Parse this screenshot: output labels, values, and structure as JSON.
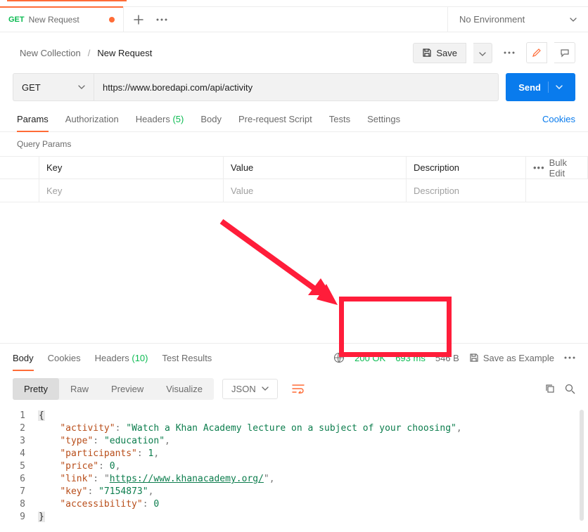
{
  "tab": {
    "method": "GET",
    "name": "New Request",
    "dirty": true
  },
  "env": {
    "label": "No Environment"
  },
  "breadcrumb": {
    "collection": "New Collection",
    "request": "New Request",
    "sep": "/"
  },
  "toolbar": {
    "save_label": "Save"
  },
  "request": {
    "method": "GET",
    "url": "https://www.boredapi.com/api/activity",
    "send_label": "Send",
    "tabs": {
      "params": "Params",
      "authorization": "Authorization",
      "headers": "Headers",
      "headers_count": "(5)",
      "body": "Body",
      "prerequest": "Pre-request Script",
      "tests": "Tests",
      "settings": "Settings"
    },
    "cookies_link": "Cookies",
    "query_params_label": "Query Params",
    "table": {
      "key_h": "Key",
      "value_h": "Value",
      "desc_h": "Description",
      "bulk_edit": "Bulk Edit",
      "key_ph": "Key",
      "value_ph": "Value",
      "desc_ph": "Description"
    }
  },
  "response": {
    "tabs": {
      "body": "Body",
      "cookies": "Cookies",
      "headers": "Headers",
      "headers_count": "(10)",
      "test_results": "Test Results"
    },
    "status": "200 OK",
    "time": "693 ms",
    "size": "546 B",
    "save_example": "Save as Example",
    "view": {
      "pretty": "Pretty",
      "raw": "Raw",
      "preview": "Preview",
      "visualize": "Visualize",
      "format": "JSON"
    },
    "body_json": {
      "activity": "Watch a Khan Academy lecture on a subject of your choosing",
      "type": "education",
      "participants": 1,
      "price": 0,
      "link": "https://www.khanacademy.org/",
      "key": "7154873",
      "accessibility": 0
    }
  }
}
